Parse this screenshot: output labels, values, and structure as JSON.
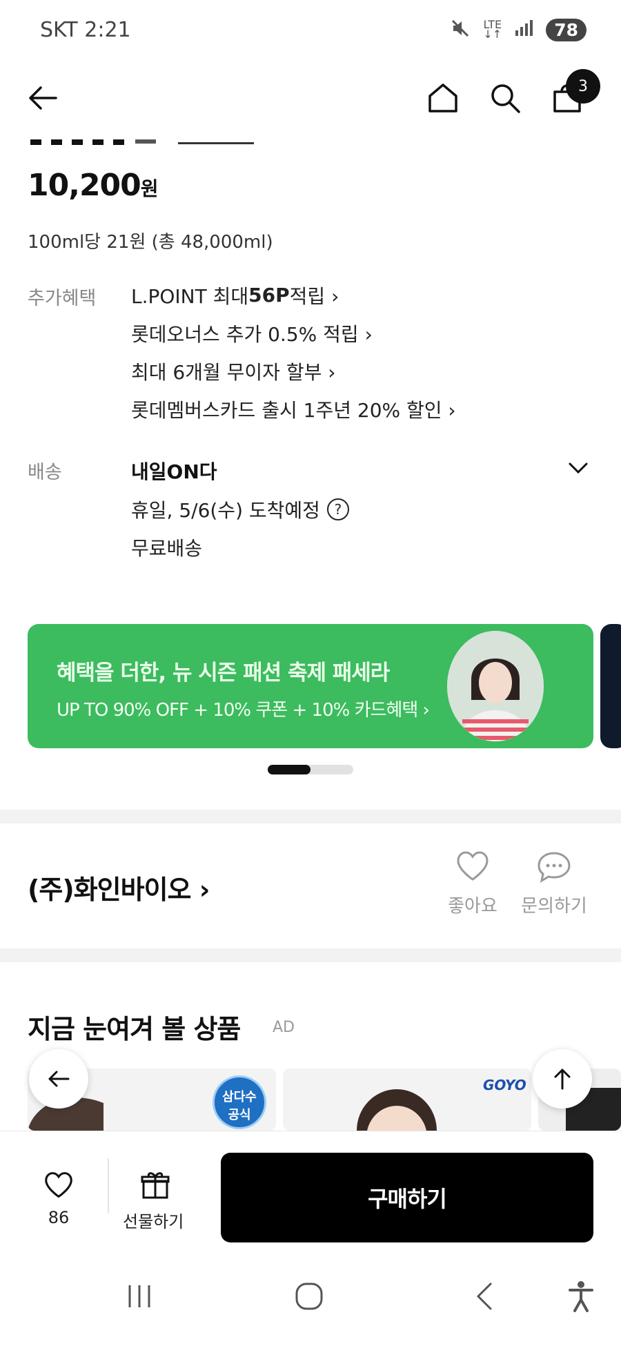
{
  "status": {
    "carrier_time": "SKT 2:21",
    "battery": "78",
    "lte": "LTE"
  },
  "header": {
    "cart_count": "3"
  },
  "product": {
    "price": "10,200",
    "price_unit": "원",
    "unit_price": "100ml당 21원 (총 48,000ml)"
  },
  "benefits": {
    "label": "추가혜택",
    "lines": [
      {
        "prefix": "L.POINT 최대 ",
        "bold": "56P",
        "suffix": " 적립 ›"
      },
      {
        "prefix": "롯데오너스 추가 0.5% 적립 ›",
        "bold": "",
        "suffix": ""
      },
      {
        "prefix": "최대 6개월 무이자 할부 ›",
        "bold": "",
        "suffix": ""
      },
      {
        "prefix": "롯데멤버스카드 출시 1주년 20% 할인 ›",
        "bold": "",
        "suffix": ""
      }
    ]
  },
  "delivery": {
    "label": "배송",
    "title": "내일ON다",
    "eta": "휴일, 5/6(수) 도착예정",
    "fee": "무료배송"
  },
  "banner": {
    "title": "혜택을 더한, 뉴 시즌 패션 축제 패세라",
    "subtitle": "UP TO 90% OFF + 10% 쿠폰 + 10% 카드혜택 ›",
    "color": "#3dbb5f"
  },
  "seller": {
    "name": "(주)화인바이오 ›",
    "like_label": "좋아요",
    "inquiry_label": "문의하기"
  },
  "recommend": {
    "title": "지금 눈여겨 볼 상품",
    "ad": "AD",
    "card1_badge_top": "삼다수",
    "card1_badge_bottom": "공식",
    "card2_brand": "GOYO"
  },
  "bottom": {
    "like_count": "86",
    "gift_label": "선물하기",
    "buy_label": "구매하기"
  }
}
